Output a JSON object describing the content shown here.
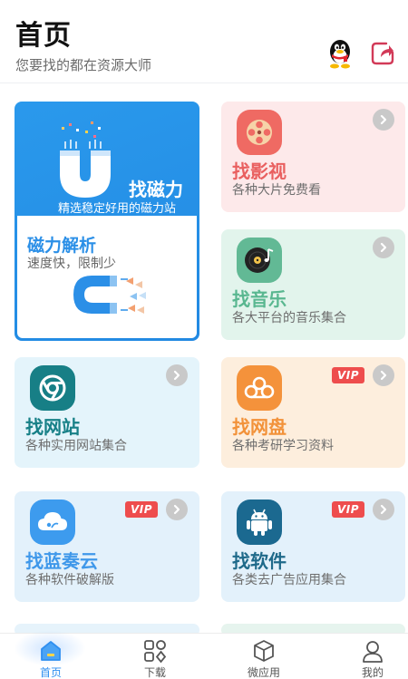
{
  "header": {
    "title": "首页",
    "subtitle": "您要找的都在资源大师",
    "icons": [
      "qq-penguin-icon",
      "share-icon"
    ]
  },
  "featured": {
    "title": "找磁力",
    "subtitle": "精选稳定好用的磁力站",
    "inner_title": "磁力解析",
    "inner_desc": "速度快，限制少",
    "color": "#2289e2"
  },
  "cards": [
    {
      "title": "找影视",
      "desc": "各种大片免费看",
      "icon": "film-reel-icon",
      "vip": false,
      "title_color": "#e96060",
      "bg": "#fde9ea"
    },
    {
      "title": "找音乐",
      "desc": "各大平台的音乐集合",
      "icon": "vinyl-record-icon",
      "vip": false,
      "title_color": "#59b790",
      "bg": "#e2f4ec"
    },
    {
      "title": "找网站",
      "desc": "各种实用网站集合",
      "icon": "chrome-browser-icon",
      "vip": false,
      "title_color": "#178087",
      "bg": "#e4f4fb"
    },
    {
      "title": "找网盘",
      "desc": "各种考研学习资料",
      "icon": "cloud-drive-icon",
      "vip": true,
      "vip_label": "VIP",
      "title_color": "#f2923a",
      "bg": "#fdeedd"
    },
    {
      "title": "找蓝奏云",
      "desc": "各种软件破解版",
      "icon": "cloud-icon",
      "vip": true,
      "vip_label": "VIP",
      "title_color": "#3f98ea",
      "bg": "#e3f1fb"
    },
    {
      "title": "找软件",
      "desc": "各类去广告应用集合",
      "icon": "android-icon",
      "vip": true,
      "vip_label": "VIP",
      "title_color": "#1f6a8a",
      "bg": "#e3f1fb"
    }
  ],
  "nav": {
    "items": [
      {
        "label": "首页",
        "icon": "home-icon",
        "active": true
      },
      {
        "label": "下载",
        "icon": "grid-icon",
        "active": false
      },
      {
        "label": "微应用",
        "icon": "cube-icon",
        "active": false
      },
      {
        "label": "我的",
        "icon": "user-icon",
        "active": false
      }
    ]
  }
}
